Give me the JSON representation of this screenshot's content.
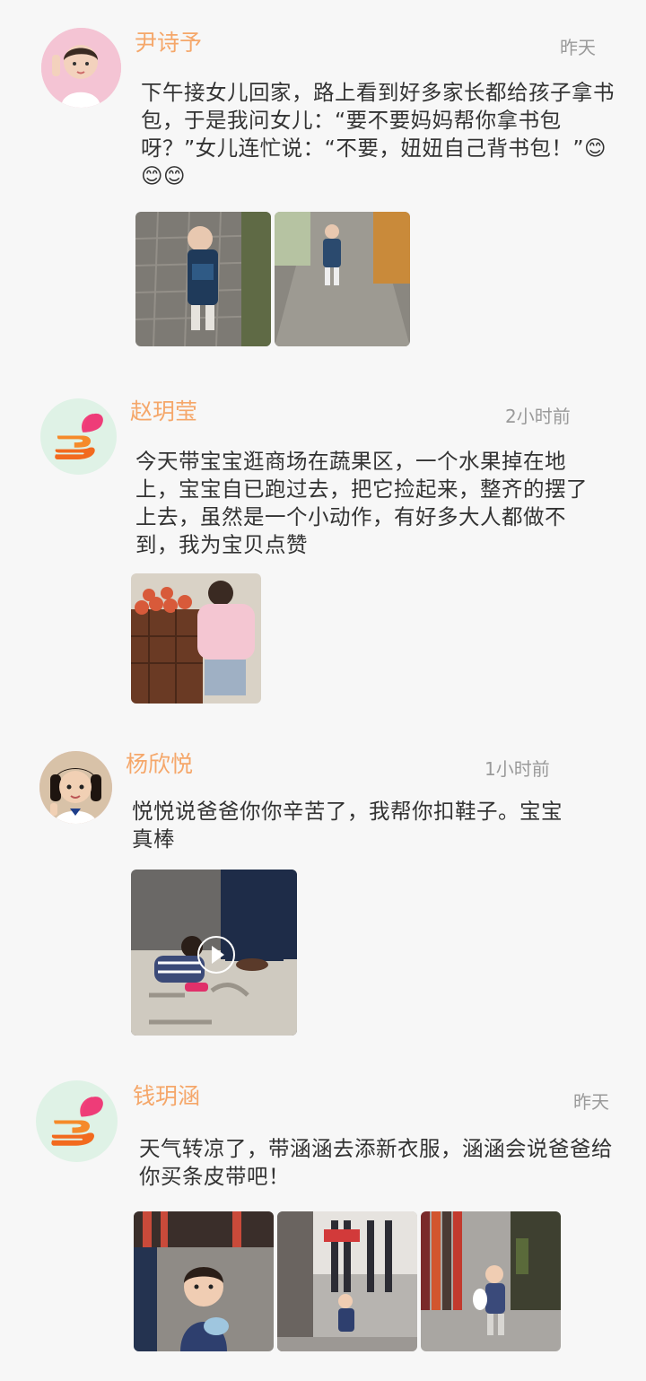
{
  "posts": [
    {
      "name": "尹诗予",
      "time": "昨天",
      "text": "下午接女儿回家，路上看到好多家长都给孩子拿书包，于是我问女儿：“要不要妈妈帮你拿书包呀？”女儿连忙说：“不要，妞妞自己背书包！”😊😊😊",
      "avatar": "child-photo",
      "media": [
        {
          "kind": "photo",
          "subject": "child-with-backpack-on-sidewalk"
        },
        {
          "kind": "photo",
          "subject": "child-walking-on-path"
        }
      ]
    },
    {
      "name": "赵玥莹",
      "time": "2小时前",
      "text": "今天带宝宝逛商场在蔬果区，一个水果掉在地上，宝宝自已跑过去，把它捡起来，整齐的摆了上去，虽然是一个小动作，有好多大人都做不到，我为宝贝点赞",
      "avatar": "app-logo",
      "media": [
        {
          "kind": "photo",
          "subject": "child-at-fruit-stand"
        }
      ]
    },
    {
      "name": "杨欣悦",
      "time": "1小时前",
      "text": "悦悦说爸爸你你辛苦了，我帮你扣鞋子。宝宝真棒",
      "avatar": "child-photo",
      "media": [
        {
          "kind": "video",
          "subject": "child-buckling-shoe",
          "icon": "play-icon"
        }
      ]
    },
    {
      "name": "钱玥涵",
      "time": "昨天",
      "text": "天气转凉了，带涵涵去添新衣服，涵涵会说爸爸给你买条皮带吧！",
      "avatar": "app-logo",
      "media": [
        {
          "kind": "photo",
          "subject": "child-in-clothing-store"
        },
        {
          "kind": "photo",
          "subject": "clothing-store-entrance"
        },
        {
          "kind": "photo",
          "subject": "child-among-clothes-racks"
        }
      ]
    }
  ]
}
